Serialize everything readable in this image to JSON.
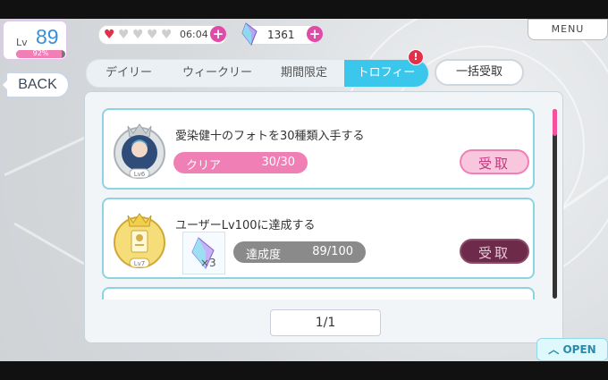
{
  "status": {
    "level_label": "Lv",
    "level": "89",
    "exp_percent": "92%",
    "exp_fraction": 0.92,
    "hearts_filled": 1,
    "hearts_total": 5,
    "stamina_timer": "06:04",
    "gem_count": "1361"
  },
  "nav": {
    "back_label": "BACK",
    "menu_label": "MENU",
    "open_label": "OPEN"
  },
  "tabs": [
    {
      "label": "デイリー",
      "active": false
    },
    {
      "label": "ウィークリー",
      "active": false
    },
    {
      "label": "期間限定",
      "active": false
    },
    {
      "label": "トロフィー",
      "active": true
    }
  ],
  "tab_badge": "!",
  "bulk_receive_label": "一括受取",
  "missions": [
    {
      "title": "愛染健十のフォトを30種類入手する",
      "medal_level": "Lv6",
      "progress_label": "クリア",
      "progress_value": "30/30",
      "progress_fraction": 1.0,
      "receive_label": "受取",
      "receive_enabled": true
    },
    {
      "title": "ユーザーLv100に達成する",
      "medal_level": "Lv7",
      "reward_qty": "×3",
      "progress_label": "達成度",
      "progress_value": "89/100",
      "progress_fraction": 0.89,
      "receive_label": "受取",
      "receive_enabled": false
    }
  ],
  "pager": "1/1",
  "colors": {
    "accent_cyan": "#3bc7ec",
    "pink": "#f07fb5",
    "magenta": "#e14ba8",
    "receive_disabled": "#6e2a4a"
  }
}
